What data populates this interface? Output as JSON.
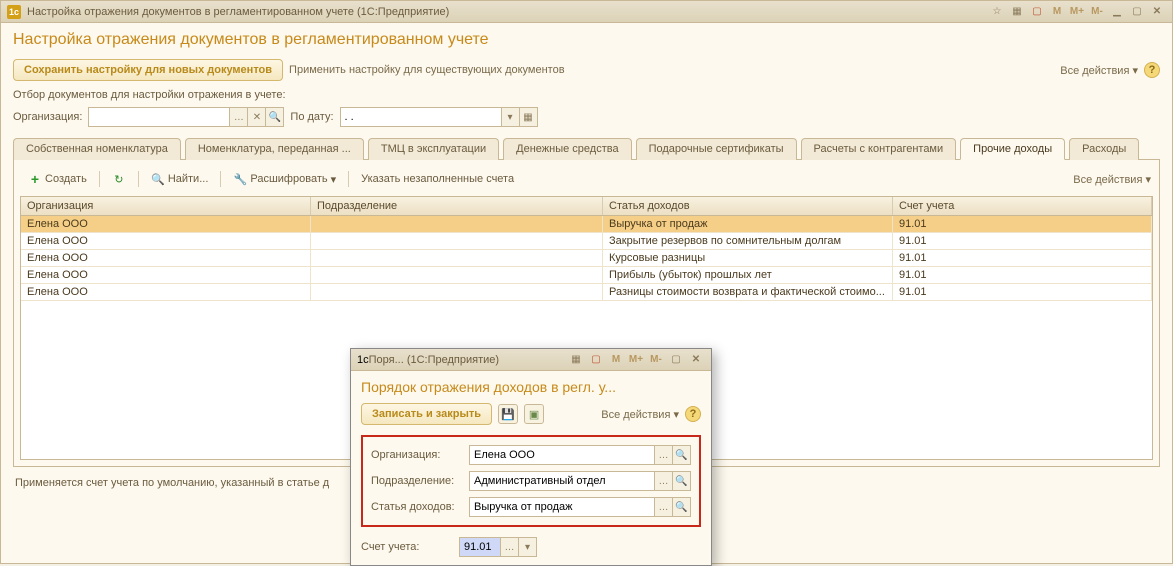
{
  "titlebar": {
    "icon_text": "1c",
    "title": "Настройка отражения документов в регламентированном учете    (1С:Предприятие)",
    "m": "M",
    "mplus": "M+",
    "mminus": "M-"
  },
  "heading": "Настройка отражения документов в регламентированном учете",
  "toolbar": {
    "save_new": "Сохранить настройку для новых документов",
    "apply_existing": "Применить настройку для существующих документов",
    "all_actions": "Все действия"
  },
  "filter": {
    "caption": "Отбор документов для настройки отражения в учете:",
    "org_label": "Организация:",
    "org_value": "",
    "date_label": "По дату:",
    "date_value": ". ."
  },
  "tabs": [
    "Собственная номенклатура",
    "Номенклатура, переданная ...",
    "ТМЦ в эксплуатации",
    "Денежные средства",
    "Подарочные сертификаты",
    "Расчеты с контрагентами",
    "Прочие доходы",
    "Расходы"
  ],
  "panel_toolbar": {
    "create": "Создать",
    "find": "Найти...",
    "decrypt": "Расшифровать",
    "unfilled": "Указать незаполненные счета",
    "all_actions": "Все действия"
  },
  "grid": {
    "cols": [
      "Организация",
      "Подразделение",
      "Статья доходов",
      "Счет учета"
    ],
    "rows": [
      {
        "org": "Елена ООО",
        "dep": "",
        "art": "Выручка от продаж",
        "acc": "91.01"
      },
      {
        "org": "Елена ООО",
        "dep": "",
        "art": "Закрытие резервов по сомнительным долгам",
        "acc": "91.01"
      },
      {
        "org": "Елена ООО",
        "dep": "",
        "art": "Курсовые разницы",
        "acc": "91.01"
      },
      {
        "org": "Елена ООО",
        "dep": "",
        "art": "Прибыль (убыток) прошлых лет",
        "acc": "91.01"
      },
      {
        "org": "Елена ООО",
        "dep": "",
        "art": "Разницы стоимости возврата и фактической стоимо...",
        "acc": "91.01"
      }
    ]
  },
  "footer": "Применяется счет учета по умолчанию, указанный в статье д",
  "dialog": {
    "tb_title": "Поря...   (1С:Предприятие)",
    "heading": "Порядок отражения доходов в регл. у...",
    "save_close": "Записать и закрыть",
    "all_actions": "Все действия",
    "fields": {
      "org_label": "Организация:",
      "org_value": "Елена ООО",
      "dep_label": "Подразделение:",
      "dep_value": "Административный отдел",
      "art_label": "Статья доходов:",
      "art_value": "Выручка от продаж"
    },
    "acc_label": "Счет учета:",
    "acc_value": "91.01",
    "m": "M",
    "mplus": "M+",
    "mminus": "M-"
  }
}
